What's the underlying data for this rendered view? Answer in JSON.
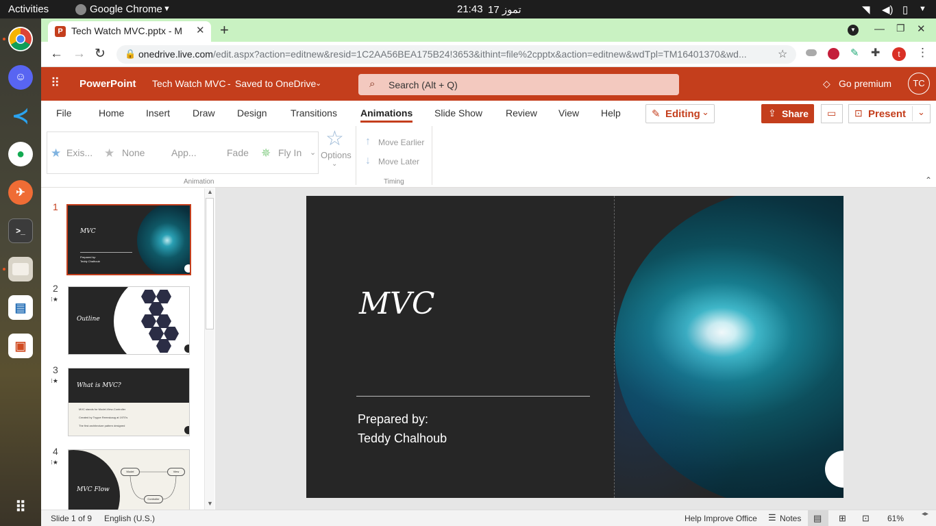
{
  "system": {
    "activities": "Activities",
    "app_name": "Google Chrome",
    "time": "21:43",
    "date": "تموز 17"
  },
  "browser": {
    "tab_title": "Tech Watch MVC.pptx - M",
    "url_domain": "onedrive.live.com",
    "url_path": "/edit.aspx?action=editnew&resid=1C2AA56BEA175B24!3653&ithint=file%2cpptx&action=editnew&wdTpl=TM16401370&wd...",
    "profile_initial": "t"
  },
  "app": {
    "name": "PowerPoint",
    "doc_title": "Tech Watch MVC",
    "save_status": "Saved to OneDrive",
    "search_placeholder": "Search (Alt + Q)",
    "go_premium": "Go premium",
    "user_initials": "TC"
  },
  "ribbon": {
    "tabs": [
      "File",
      "Home",
      "Insert",
      "Draw",
      "Design",
      "Transitions",
      "Animations",
      "Slide Show",
      "Review",
      "View",
      "Help"
    ],
    "active_tab": "Animations",
    "editing_label": "Editing",
    "share_label": "Share",
    "present_label": "Present",
    "animations": [
      "Exis...",
      "None",
      "App...",
      "Fade",
      "Fly In"
    ],
    "options_label": "Options",
    "group_animation": "Animation",
    "move_earlier": "Move Earlier",
    "move_later": "Move Later",
    "group_timing": "Timing"
  },
  "slides": [
    {
      "num": "1",
      "title": "MVC",
      "line1": "Prepared by:",
      "line2": "Teddy Chalhoub"
    },
    {
      "num": "2",
      "title": "Outline"
    },
    {
      "num": "3",
      "title": "What is MVC?",
      "bullets": [
        "MVC stands for Model-View-Controller",
        "Created by Trygve Reenskaug at 1970's",
        "The first architecture pattern designed"
      ]
    },
    {
      "num": "4",
      "title": "MVC Flow",
      "nodes": [
        "Model",
        "View",
        "Controller"
      ]
    }
  ],
  "main_slide": {
    "title": "MVC",
    "prepared": "Prepared by:",
    "author": "Teddy Chalhoub"
  },
  "status": {
    "slide_count": "Slide 1 of 9",
    "language": "English (U.S.)",
    "help": "Help Improve Office",
    "notes": "Notes",
    "zoom": "61%"
  },
  "colors": {
    "accent": "#c43e1c",
    "tab_strip": "#c9f2c2",
    "slide_bg": "#262626"
  }
}
